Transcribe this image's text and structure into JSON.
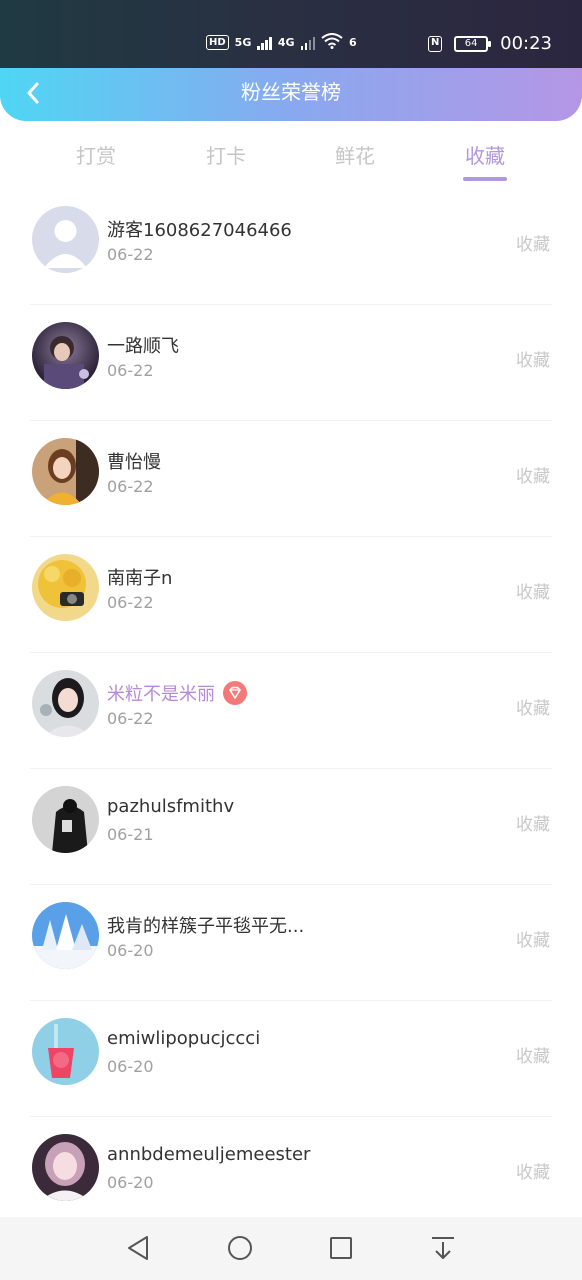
{
  "status_bar": {
    "time": "00:23",
    "hd": "HD",
    "net1": "5G",
    "net2": "4G",
    "net3": "6",
    "nfc": "N",
    "battery": "64"
  },
  "header": {
    "title": "粉丝荣誉榜",
    "back_icon": "chevron-left-icon"
  },
  "tabs": [
    {
      "label": "打赏",
      "active": false
    },
    {
      "label": "打卡",
      "active": false
    },
    {
      "label": "鲜花",
      "active": false
    },
    {
      "label": "收藏",
      "active": true
    }
  ],
  "rows": [
    {
      "name": "游客1608627046466",
      "date": "06-22",
      "action": "收藏",
      "vip": false
    },
    {
      "name": "一路顺飞",
      "date": "06-22",
      "action": "收藏",
      "vip": false
    },
    {
      "name": "曹怡慢",
      "date": "06-22",
      "action": "收藏",
      "vip": false
    },
    {
      "name": "南南子n",
      "date": "06-22",
      "action": "收藏",
      "vip": false
    },
    {
      "name": "米粒不是米丽",
      "date": "06-22",
      "action": "收藏",
      "vip": true
    },
    {
      "name": "pazhulsfmithv",
      "date": "06-21",
      "action": "收藏",
      "vip": false
    },
    {
      "name": "我肯的样簇子平毯平无...",
      "date": "06-20",
      "action": "收藏",
      "vip": false
    },
    {
      "name": "emiwlipopucjccci",
      "date": "06-20",
      "action": "收藏",
      "vip": false
    },
    {
      "name": "annbdemeuljemeester",
      "date": "06-20",
      "action": "收藏",
      "vip": false
    }
  ],
  "colors": {
    "accent": "#b296df",
    "header_start": "#4fd6f4",
    "header_end": "#b596e6",
    "vip_name": "#b68ad9",
    "gem": "#f47a7a"
  },
  "nav": {
    "back_icon": "triangle-back-icon",
    "home_icon": "circle-home-icon",
    "recents_icon": "square-recents-icon",
    "notification_icon": "pull-down-icon"
  }
}
